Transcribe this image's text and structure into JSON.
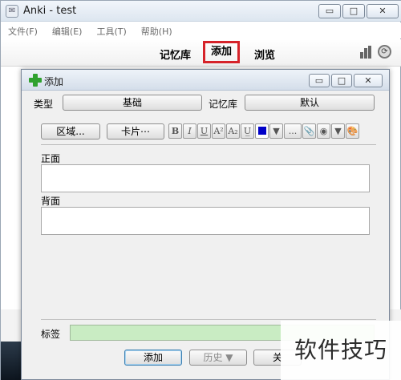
{
  "main_window": {
    "title": "Anki - test",
    "controls": {
      "minimize": "▭",
      "maximize": "□",
      "close": "✕"
    },
    "menu": [
      {
        "label": "文件(F)"
      },
      {
        "label": "编辑(E)"
      },
      {
        "label": "工具(T)"
      },
      {
        "label": "帮助(H)"
      }
    ],
    "toolbar": {
      "decks": "记忆库",
      "add": "添加",
      "browse": "浏览"
    },
    "icons": [
      "app-icon",
      "stats-icon",
      "sync-icon"
    ]
  },
  "add_dialog": {
    "title": "添加",
    "controls": {
      "minimize": "▭",
      "maximize": "□",
      "close": "✕"
    },
    "type_label": "类型",
    "type_value": "基础",
    "deck_label": "记忆库",
    "deck_value": "默认",
    "fields_button": "区域...",
    "cards_button": "卡片⋯",
    "format_buttons": [
      "B",
      "I",
      "U",
      "A²",
      "A₂",
      "U̲",
      "",
      "▼",
      "...",
      "📎",
      "◉",
      "▼",
      "🎨"
    ],
    "fields": [
      {
        "label": "正面",
        "value": ""
      },
      {
        "label": "背面",
        "value": ""
      }
    ],
    "tags_label": "标签",
    "tags_value": "",
    "add_button": "添加",
    "history_button": "历史 ▼",
    "close_button": "关"
  },
  "watermark": "软件技巧",
  "colors": {
    "highlight_border": "#d6232a",
    "tags_background": "#c9ecc3",
    "font_color_swatch": "#0000c8"
  }
}
